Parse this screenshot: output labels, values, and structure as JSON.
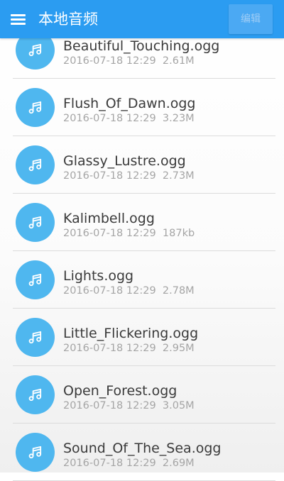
{
  "header": {
    "title": "本地音频",
    "edit_label": "编辑",
    "menu_icon": "hamburger-menu-icon",
    "bar_color": "#2b9cf1"
  },
  "files": [
    {
      "name": "Beautiful_Touching.ogg",
      "date": "2016-07-18 12:29",
      "size": "2.61M"
    },
    {
      "name": "Flush_Of_Dawn.ogg",
      "date": "2016-07-18 12:29",
      "size": "3.23M"
    },
    {
      "name": "Glassy_Lustre.ogg",
      "date": "2016-07-18 12:29",
      "size": "2.73M"
    },
    {
      "name": "Kalimbell.ogg",
      "date": "2016-07-18 12:29",
      "size": "187kb"
    },
    {
      "name": "Lights.ogg",
      "date": "2016-07-18 12:29",
      "size": "2.78M"
    },
    {
      "name": "Little_Flickering.ogg",
      "date": "2016-07-18 12:29",
      "size": "2.95M"
    },
    {
      "name": "Open_Forest.ogg",
      "date": "2016-07-18 12:29",
      "size": "3.05M"
    },
    {
      "name": "Sound_Of_The_Sea.ogg",
      "date": "2016-07-18 12:29",
      "size": "2.69M"
    }
  ],
  "file_icon": "music-note-icon",
  "icon_color": "#4fb7ef"
}
